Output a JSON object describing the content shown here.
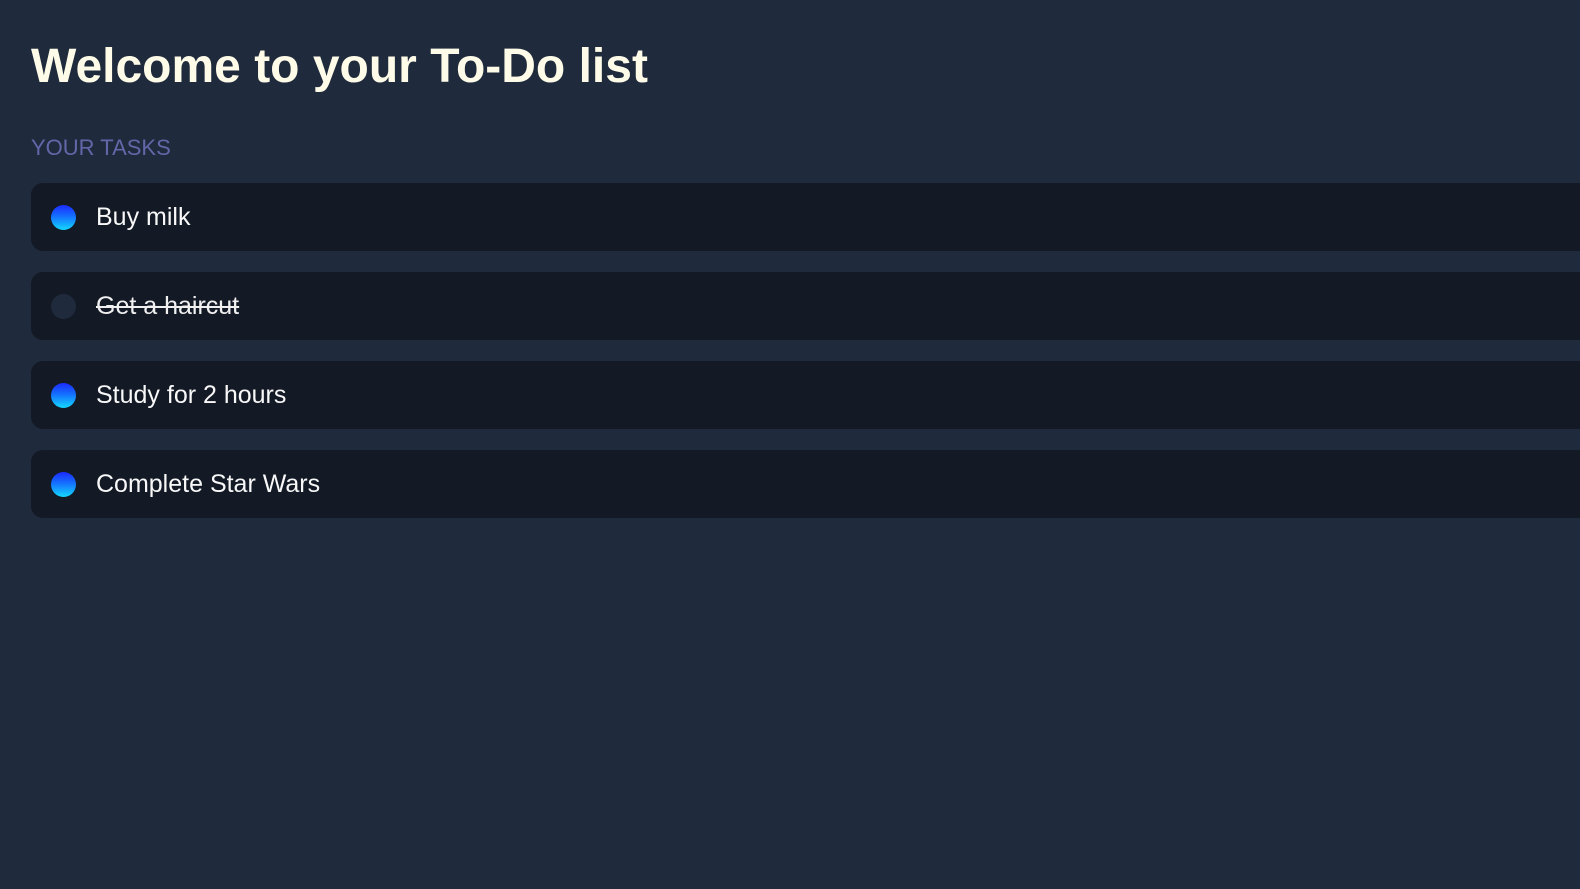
{
  "header": {
    "title": "Welcome to your To-Do list"
  },
  "tasks_section": {
    "heading": "YOUR TASKS",
    "items": [
      {
        "label": "Buy milk",
        "completed": false
      },
      {
        "label": "Get a haircut",
        "completed": true
      },
      {
        "label": "Study for 2 hours",
        "completed": false
      },
      {
        "label": "Complete Star Wars",
        "completed": false
      }
    ]
  },
  "colors": {
    "background": "#1f2a3c",
    "card": "#131925",
    "title": "#fefce8",
    "section_heading": "#6366a8",
    "toggle_gradient_top": "#1d2bff",
    "toggle_gradient_bottom": "#14d8ff",
    "toggle_completed": "#1f2a3c"
  }
}
